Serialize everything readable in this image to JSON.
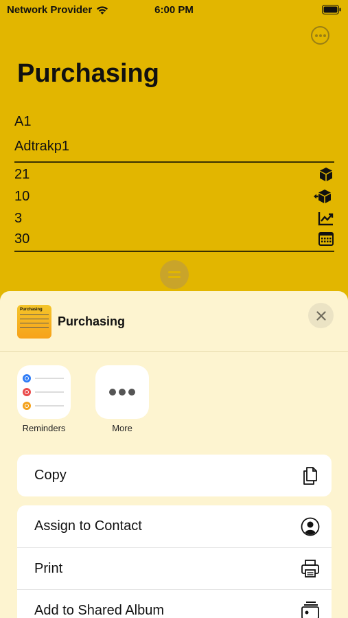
{
  "status": {
    "provider": "Network Provider",
    "time": "6:00 PM"
  },
  "note": {
    "title": "Purchasing",
    "field1": "A1",
    "field2": "Adtrakp1",
    "rows": [
      {
        "value": "21",
        "icon": "box-icon"
      },
      {
        "value": "10",
        "icon": "box-arrows-icon"
      },
      {
        "value": "3",
        "icon": "chart-up-icon"
      },
      {
        "value": "30",
        "icon": "calendar-icon"
      }
    ]
  },
  "share": {
    "title": "Purchasing",
    "thumb_title": "Purchasing",
    "apps": [
      {
        "label": "Reminders",
        "icon": "reminders-icon"
      },
      {
        "label": "More",
        "icon": "more-dots-icon"
      }
    ],
    "actions_group1": [
      {
        "label": "Copy",
        "icon": "copy-icon"
      }
    ],
    "actions_group2": [
      {
        "label": "Assign to Contact",
        "icon": "contact-icon"
      },
      {
        "label": "Print",
        "icon": "printer-icon"
      },
      {
        "label": "Add to Shared Album",
        "icon": "shared-album-icon"
      }
    ]
  },
  "colors": {
    "background": "#e2b600",
    "sheet": "#fdf4d0"
  }
}
